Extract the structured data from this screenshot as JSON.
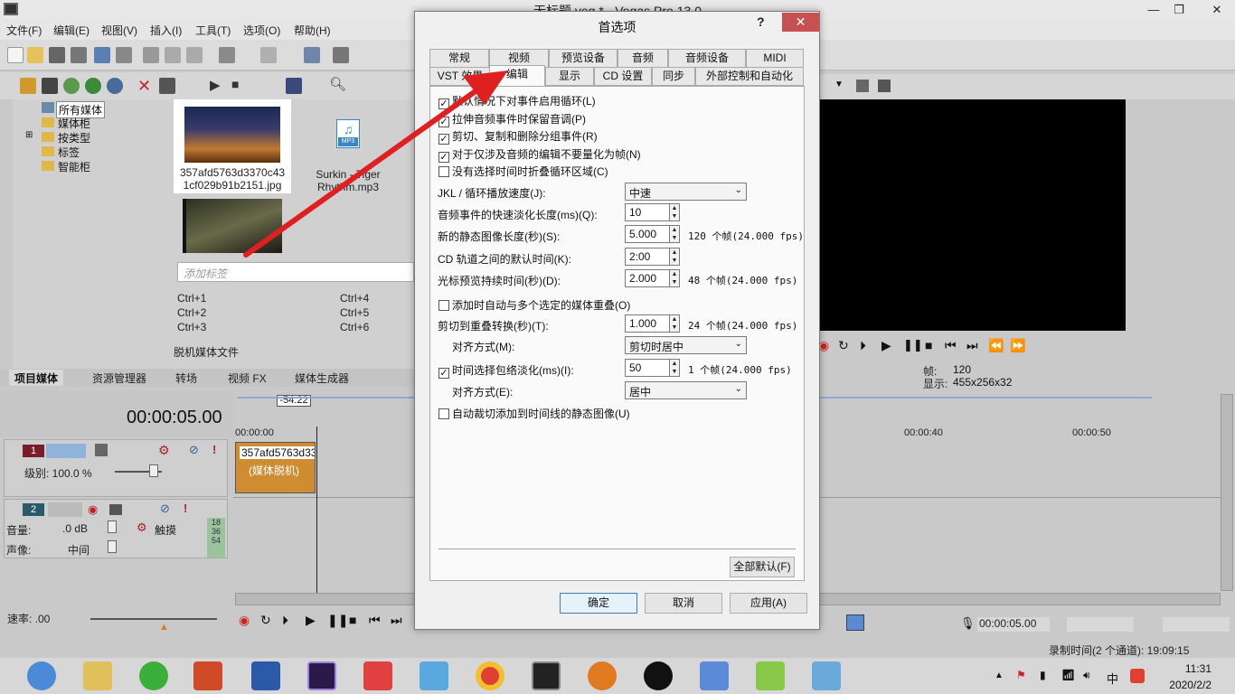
{
  "app": {
    "title": "无标题.veg * - Vegas Pro 13.0",
    "menu": [
      "文件(F)",
      "编辑(E)",
      "视图(V)",
      "插入(I)",
      "工具(T)",
      "选项(O)",
      "帮助(H)"
    ]
  },
  "media_tree": {
    "items": [
      "所有媒体",
      "媒体柜",
      "按类型",
      "标签",
      "智能柜"
    ]
  },
  "media_files": {
    "file1": "357afd5763d3370c43\n1cf029b91b2151.jpg",
    "file2": "Surkin - Tiger\nRhythm.mp3",
    "mp3_badge": "MP3"
  },
  "tag_placeholder": "添加标签",
  "shortcuts": [
    "Ctrl+1",
    "Ctrl+2",
    "Ctrl+3",
    "Ctrl+4",
    "Ctrl+5",
    "Ctrl+6"
  ],
  "offline_label": "脱机媒体文件",
  "panel_tabs": [
    "项目媒体",
    "资源管理器",
    "转场",
    "视频 FX",
    "媒体生成器"
  ],
  "timeline": {
    "timecode": "00:00:05.00",
    "marker": "-54.22",
    "ruler": [
      "00:00:00",
      "00:00:40",
      "00:00:50"
    ],
    "track1": {
      "num": "1",
      "level_label": "级别: 100.0 %"
    },
    "track2": {
      "num": "2",
      "volume_label": "音量:",
      "volume_value": ".0 dB",
      "touch_label": "触摸",
      "pan_label": "声像:",
      "pan_value": "中间",
      "meter": [
        "18",
        "36",
        "54"
      ]
    },
    "clip_title": "357afd5763d33",
    "clip_sub": "(媒体脱机)",
    "rate_label": "速率: .00"
  },
  "preview": {
    "frame_label": "帧:",
    "frame_value": "120",
    "display_label": "显示:",
    "display_value": "455x256x32"
  },
  "status": {
    "time": "00:00:05.00",
    "record_time": "录制时间(2 个通道): 19:09:15"
  },
  "taskbar": {
    "time": "11:31",
    "date": "2020/2/2",
    "ime": "中"
  },
  "dialog": {
    "title": "首选项",
    "help": "?",
    "close": "✕",
    "tabs_row1": [
      "常规",
      "视频",
      "预览设备",
      "音频",
      "音频设备",
      "MIDI"
    ],
    "tabs_row2": [
      "VST 效果",
      "编辑",
      "显示",
      "CD 设置",
      "同步",
      "外部控制和自动化"
    ],
    "active_tab": "编辑",
    "checkboxes": [
      {
        "label": "默认情况下对事件启用循环(L)",
        "checked": true
      },
      {
        "label": "拉伸音频事件时保留音调(P)",
        "checked": true
      },
      {
        "label": "剪切、复制和删除分组事件(R)",
        "checked": true
      },
      {
        "label": "对于仅涉及音频的编辑不要量化为帧(N)",
        "checked": true
      },
      {
        "label": "没有选择时间时折叠循环区域(C)",
        "checked": false
      }
    ],
    "jkl_label": "JKL / 循环播放速度(J):",
    "jkl_value": "中速",
    "fade_label": "音频事件的快速淡化长度(ms)(Q):",
    "fade_value": "10",
    "still_label": "新的静态图像长度(秒)(S):",
    "still_value": "5.000",
    "still_note": "120 个帧(24.000 fps)",
    "cd_label": "CD 轨道之间的默认时间(K):",
    "cd_value": "2:00",
    "cursor_label": "光标预览持续时间(秒)(D):",
    "cursor_value": "2.000",
    "cursor_note": "48 个帧(24.000 fps)",
    "overlap_label": "添加时自动与多个选定的媒体重叠(O)",
    "overlap_checked": false,
    "cut_label": "剪切到重叠转换(秒)(T):",
    "cut_value": "1.000",
    "cut_note": "24 个帧(24.000 fps)",
    "align1_label": "对齐方式(M):",
    "align1_value": "剪切时居中",
    "env_label": "时间选择包络淡化(ms)(I):",
    "env_checked": true,
    "env_value": "50",
    "env_note": "1 个帧(24.000 fps)",
    "align2_label": "对齐方式(E):",
    "align2_value": "居中",
    "autocrop_label": "自动裁切添加到时间线的静态图像(U)",
    "autocrop_checked": false,
    "reset_all": "全部默认(F)",
    "ok": "确定",
    "cancel": "取消",
    "apply": "应用(A)"
  },
  "colors": {
    "annotation_arrow": "#e02020",
    "track_header": "#7b1c2c",
    "preview_bg": "#000000",
    "close_button": "#c75050"
  }
}
